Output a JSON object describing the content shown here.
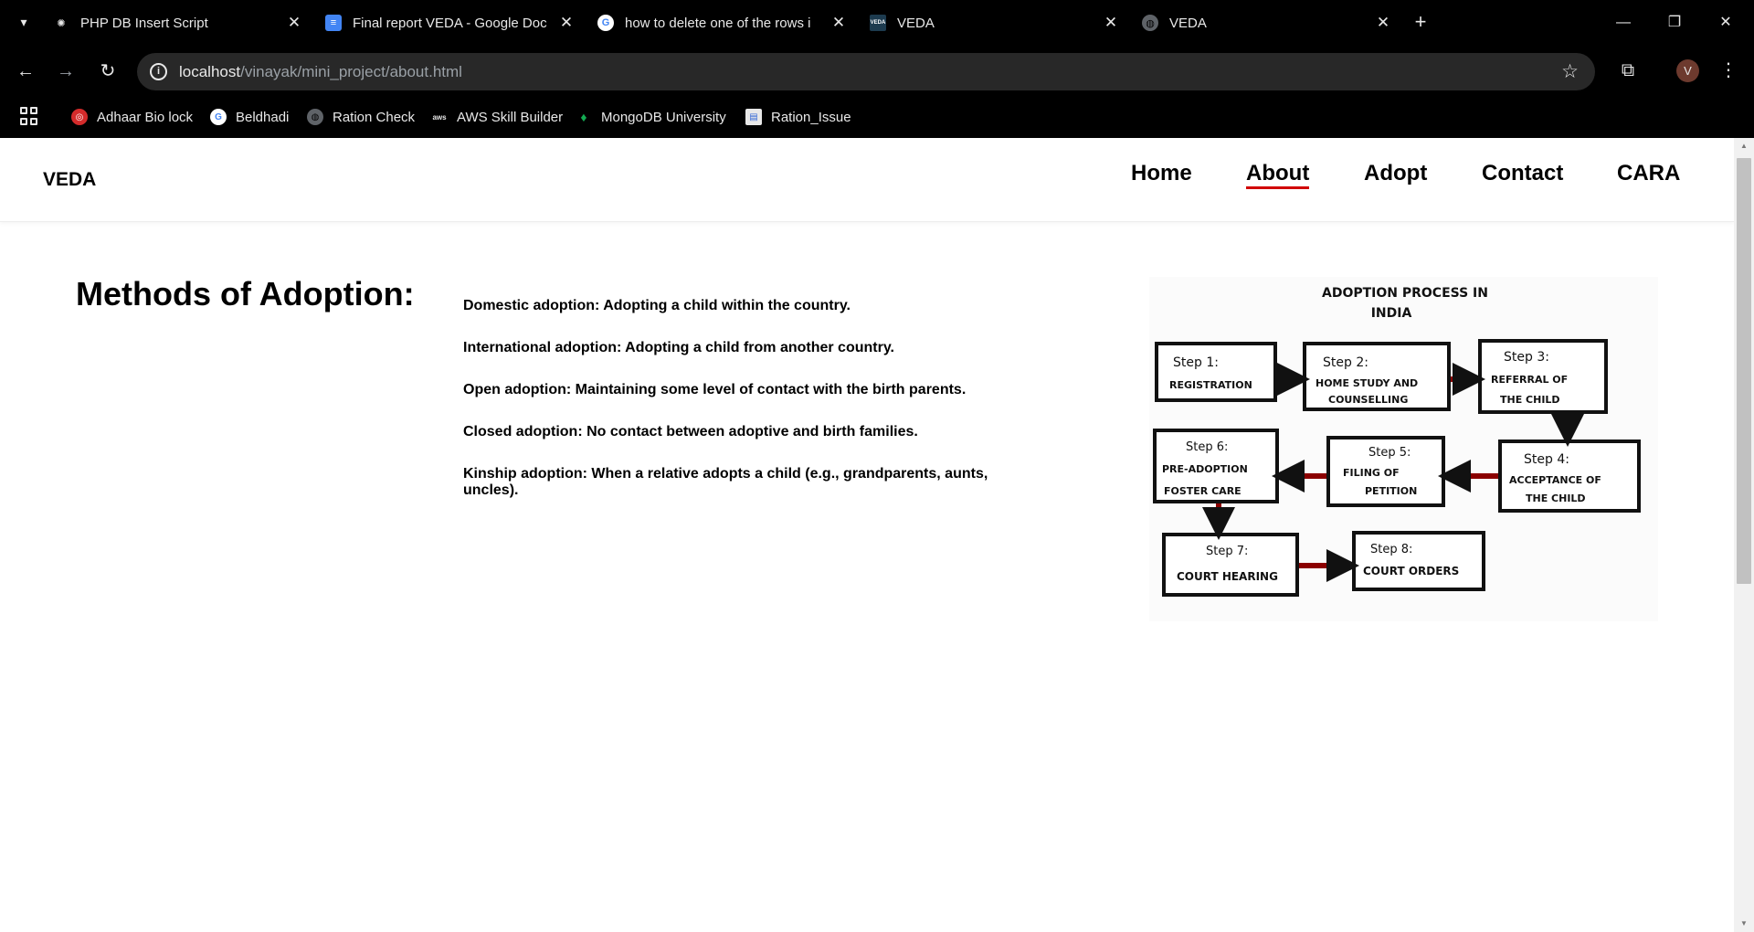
{
  "browser": {
    "tabs": [
      {
        "title": "PHP DB Insert Script",
        "icon": "chatgpt-icon",
        "icon_color": "#e8e8e8"
      },
      {
        "title": "Final report VEDA - Google Doc",
        "icon": "google-docs-icon",
        "icon_color": "#4285f4"
      },
      {
        "title": "how to delete one of the rows i",
        "icon": "google-icon",
        "icon_color": "#e8e8e8"
      },
      {
        "title": "VEDA",
        "icon": "veda-icon",
        "icon_color": "#1d3b4f"
      },
      {
        "title": "VEDA",
        "icon": "globe-icon",
        "icon_color": "#9aa0a6"
      }
    ],
    "address": {
      "host": "localhost",
      "path": "/vinayak/mini_project/about.html"
    },
    "profile_initial": "V",
    "bookmarks": [
      {
        "label": "Adhaar Bio lock",
        "icon": "aadhaar-icon"
      },
      {
        "label": "Beldhadi",
        "icon": "google-icon"
      },
      {
        "label": "Ration Check",
        "icon": "globe-icon"
      },
      {
        "label": "AWS Skill Builder",
        "icon": "aws-icon"
      },
      {
        "label": "MongoDB University",
        "icon": "mongodb-icon"
      },
      {
        "label": "Ration_Issue",
        "icon": "document-icon"
      }
    ]
  },
  "site": {
    "brand": "VEDA",
    "nav": [
      {
        "label": "Home",
        "active": false
      },
      {
        "label": "About",
        "active": true
      },
      {
        "label": "Adopt",
        "active": false
      },
      {
        "label": "Contact",
        "active": false
      },
      {
        "label": "CARA",
        "active": false
      }
    ],
    "accent_color": "#d10000"
  },
  "main": {
    "title": "Methods of Adoption:",
    "methods": [
      "Domestic adoption: Adopting a child within the country.",
      "International adoption: Adopting a child from another country.",
      "Open adoption: Maintaining some level of contact with the birth parents.",
      "Closed adoption: No contact between adoptive and birth families.",
      "Kinship adoption: When a relative adopts a child (e.g., grandparents, aunts, uncles)."
    ]
  },
  "diagram": {
    "title_line1": "ADOPTION PROCESS IN",
    "title_line2": "INDIA",
    "steps": [
      {
        "step": "Step 1:",
        "lines": [
          "REGISTRATION"
        ]
      },
      {
        "step": "Step 2:",
        "lines": [
          "HOME STUDY AND",
          "COUNSELLING"
        ]
      },
      {
        "step": "Step 3:",
        "lines": [
          "REFERRAL OF",
          "THE CHILD"
        ]
      },
      {
        "step": "Step 4:",
        "lines": [
          "ACCEPTANCE OF",
          "THE CHILD"
        ]
      },
      {
        "step": "Step 5:",
        "lines": [
          "FILING OF",
          "PETITION"
        ]
      },
      {
        "step": "Step 6:",
        "lines": [
          "PRE-ADOPTION",
          "FOSTER CARE"
        ]
      },
      {
        "step": "Step 7:",
        "lines": [
          "COURT HEARING"
        ]
      },
      {
        "step": "Step 8:",
        "lines": [
          "COURT ORDERS"
        ]
      }
    ],
    "arrow_color": "#8b0000"
  }
}
